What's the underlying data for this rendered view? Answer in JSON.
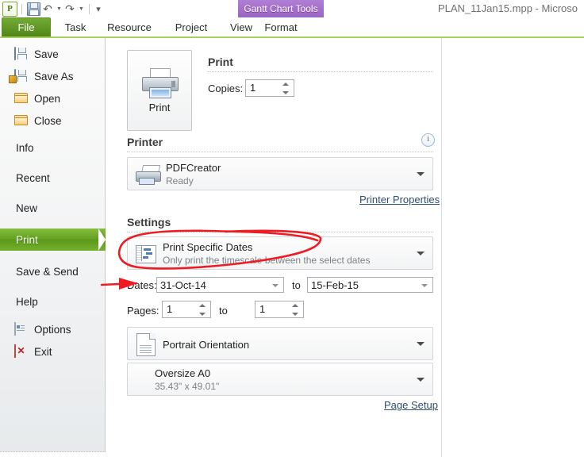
{
  "window": {
    "document_title": "PLAN_11Jan15.mpp - Microso"
  },
  "quick_access": {
    "app_logo": "project-logo",
    "items": [
      {
        "name": "save-icon",
        "label": "Save"
      },
      {
        "name": "undo-icon",
        "label": "Undo"
      },
      {
        "name": "redo-icon",
        "label": "Redo"
      },
      {
        "name": "customize-qat-icon",
        "label": "Customize Quick Access Toolbar"
      }
    ]
  },
  "contextual_tab": {
    "group_title": "Gantt Chart Tools",
    "tab_label": "Format"
  },
  "ribbon": {
    "tabs": [
      {
        "label": "File",
        "selected": true
      },
      {
        "label": "Task",
        "selected": false
      },
      {
        "label": "Resource",
        "selected": false
      },
      {
        "label": "Project",
        "selected": false
      },
      {
        "label": "View",
        "selected": false
      }
    ]
  },
  "sidebar": {
    "items": [
      {
        "label": "Save",
        "icon": "floppy-disk-icon",
        "selected": false
      },
      {
        "label": "Save As",
        "icon": "save-as-icon",
        "selected": false
      },
      {
        "label": "Open",
        "icon": "open-folder-icon",
        "selected": false
      },
      {
        "label": "Close",
        "icon": "close-folder-icon",
        "selected": false
      },
      {
        "label": "Info",
        "icon": "",
        "selected": false
      },
      {
        "label": "Recent",
        "icon": "",
        "selected": false
      },
      {
        "label": "New",
        "icon": "",
        "selected": false
      },
      {
        "label": "Print",
        "icon": "",
        "selected": true
      },
      {
        "label": "Save & Send",
        "icon": "",
        "selected": false
      },
      {
        "label": "Help",
        "icon": "",
        "selected": false
      },
      {
        "label": "Options",
        "icon": "options-icon",
        "selected": false
      },
      {
        "label": "Exit",
        "icon": "exit-icon",
        "selected": false
      }
    ]
  },
  "print_pane": {
    "print_button_label": "Print",
    "print_section_title": "Print",
    "copies_label": "Copies:",
    "copies_value": "1",
    "printer_section_title": "Printer",
    "printer_info_icon": "info-icon",
    "printer_name": "PDFCreator",
    "printer_status": "Ready",
    "printer_properties_link": "Printer Properties",
    "settings_section_title": "Settings",
    "print_range_title": "Print Specific Dates",
    "print_range_desc": "Only print the timescale between the select dates",
    "dates_label": "Dates:",
    "date_from": "31-Oct-14",
    "dates_to_label": "to",
    "date_to": "15-Feb-15",
    "pages_label": "Pages:",
    "page_from": "1",
    "pages_to_label": "to",
    "page_to": "1",
    "orientation": "Portrait Orientation",
    "paper_size": "Oversize A0",
    "paper_dims": "35.43\" x 49.01\"",
    "page_setup_link": "Page Setup"
  },
  "annotations": {
    "ellipse_color": "#ee1c22",
    "arrow_color": "#ee1c22",
    "ellipse_target": "print-specific-dates-combo",
    "arrow_target": "dates-label"
  },
  "colors": {
    "file_tab_green": "#5d9a1c",
    "selected_nav_green": "#63a11f",
    "contextual_purple": "#a56bca",
    "ribbon_underline": "#a6cf5f",
    "link_blue": "#2d4d73"
  }
}
